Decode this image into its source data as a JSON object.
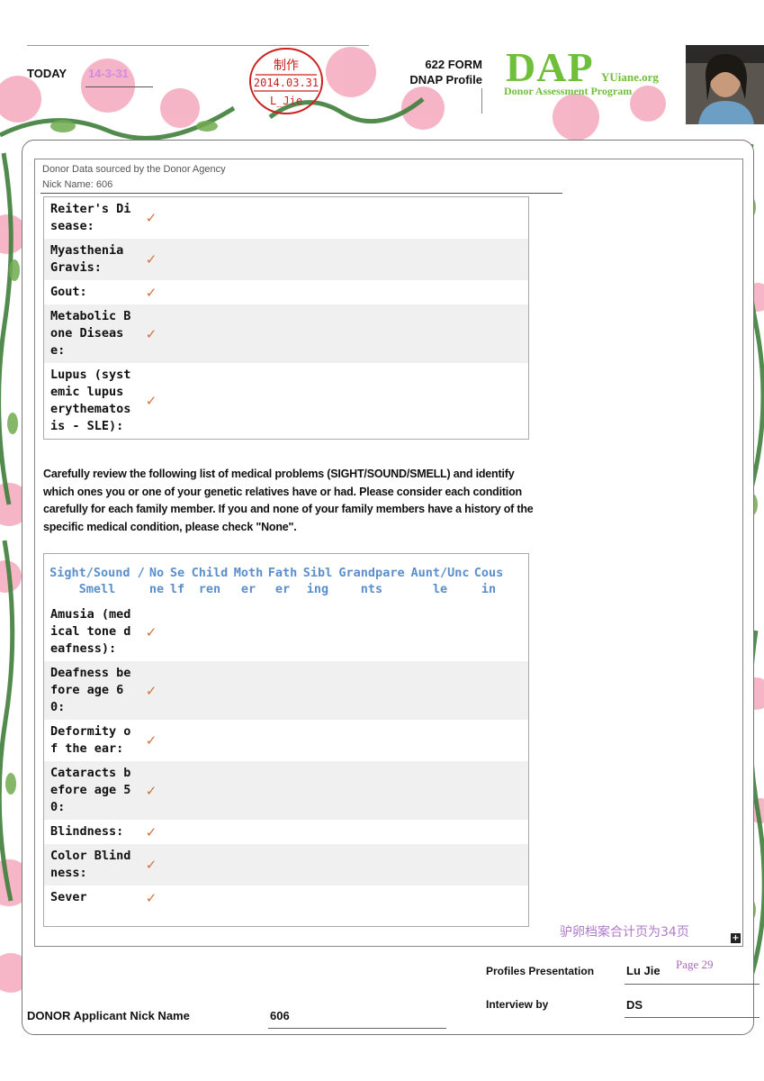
{
  "header": {
    "today_label": "TODAY",
    "today_date": "14-3-31",
    "stamp": {
      "line1": "制作",
      "line2": "2014.03.31",
      "line3": "L_Jie"
    },
    "form_title": "622 FORM",
    "form_subtitle": "DNAP Profile",
    "logo_main": "DAP",
    "logo_domain": "YUiane.org",
    "logo_sub": "Donor Assessment Program"
  },
  "panel": {
    "source_line": "Donor Data sourced by the Donor Agency",
    "nick_line": "Nick Name: 606",
    "check_mark": "✓",
    "table1_rows": [
      {
        "label": "Reiter's Disease:"
      },
      {
        "label": "Myasthenia Gravis:"
      },
      {
        "label": "Gout:"
      },
      {
        "label": "Metabolic Bone Disease:"
      },
      {
        "label": "Lupus (systemic lupus erythematosis - SLE):"
      }
    ],
    "instructions": "Carefully review the following list of medical problems (SIGHT/SOUND/SMELL) and identify which ones you or one of your genetic relatives have or had. Please consider each condition carefully for each family member. If you and none of your family members have a history of the specific medical condition, please check \"None\".",
    "table2_headers": [
      "Sight/Sound /Smell",
      "None",
      "Self",
      "Children",
      "Mother",
      "Father",
      "Sibling",
      "Grandparents",
      "Aunt/Uncle",
      "Cousin"
    ],
    "table2_rows": [
      {
        "label": "Amusia (medical tone deafness):"
      },
      {
        "label": "Deafness before age 60:"
      },
      {
        "label": "Deformity of the ear:"
      },
      {
        "label": "Cataracts before age 50:"
      },
      {
        "label": "Blindness:"
      },
      {
        "label": "Color Blindness:"
      },
      {
        "label": "Sever"
      }
    ],
    "page_count_note": "驴卵档案合计页为34页",
    "expand_glyph": "+"
  },
  "footer": {
    "profiles_label": "Profiles Presentation",
    "profiles_value": "Lu Jie",
    "page_label": "Page 29",
    "interview_label": "Interview by",
    "interview_value": "DS",
    "donor_label": "DONOR Applicant Nick Name",
    "donor_value": "606"
  }
}
